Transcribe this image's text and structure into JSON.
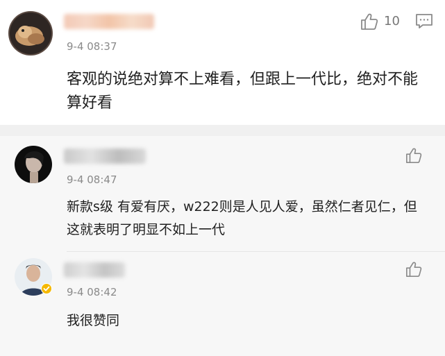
{
  "main_comment": {
    "time": "9-4 08:37",
    "text": "客观的说绝对算不上难看，但跟上一代比，绝对不能算好看",
    "like_count": "10"
  },
  "replies": [
    {
      "time": "9-4 08:47",
      "text": "新款s级 有爱有厌，w222则是人见人爱，虽然仁者见仁，但这就表明了明显不如上一代"
    },
    {
      "time": "9-4 08:42",
      "text": "我很赞同"
    }
  ],
  "icons": {
    "like": "thumbs-up-icon",
    "comment": "comment-icon",
    "verified": "verified-badge-icon"
  },
  "colors": {
    "background": "#ffffff",
    "reply_background": "#f7f7f7",
    "divider": "#f0f0f0",
    "timestamp": "#8a8a8a",
    "verified_badge": "#f5b800"
  }
}
